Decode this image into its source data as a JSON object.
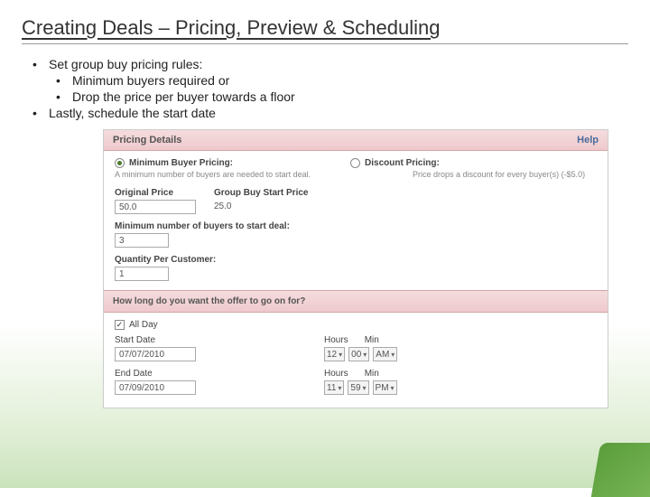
{
  "title": "Creating Deals – Pricing, Preview & Scheduling",
  "bullets": {
    "b1": "Set group buy pricing rules:",
    "b1a": "Minimum buyers required or",
    "b1b": "Drop the price per buyer towards a floor",
    "b2": "Lastly, schedule the start date"
  },
  "pricing": {
    "header": "Pricing Details",
    "help": "Help",
    "opt1": "Minimum Buyer Pricing:",
    "opt2": "Discount Pricing:",
    "desc1": "A minimum number of buyers are needed to start deal.",
    "desc2": "Price drops a discount for every buyer(s) (-$5.0)",
    "original_label": "Original Price",
    "original_value": "50.0",
    "groupbuy_label": "Group Buy Start Price",
    "groupbuy_value": "25.0",
    "minbuyers_label": "Minimum number of buyers to start deal:",
    "minbuyers_value": "3",
    "qty_label": "Quantity Per Customer:",
    "qty_value": "1"
  },
  "schedule": {
    "header": "How long do you want the offer to go on for?",
    "allday": "All Day",
    "start_label": "Start Date",
    "start_value": "07/07/2010",
    "end_label": "End Date",
    "end_value": "07/09/2010",
    "hours_label": "Hours",
    "min_label": "Min",
    "start_hours": "12",
    "start_min": "00",
    "start_ampm": "AM",
    "end_hours": "11",
    "end_min": "59",
    "end_ampm": "PM"
  }
}
